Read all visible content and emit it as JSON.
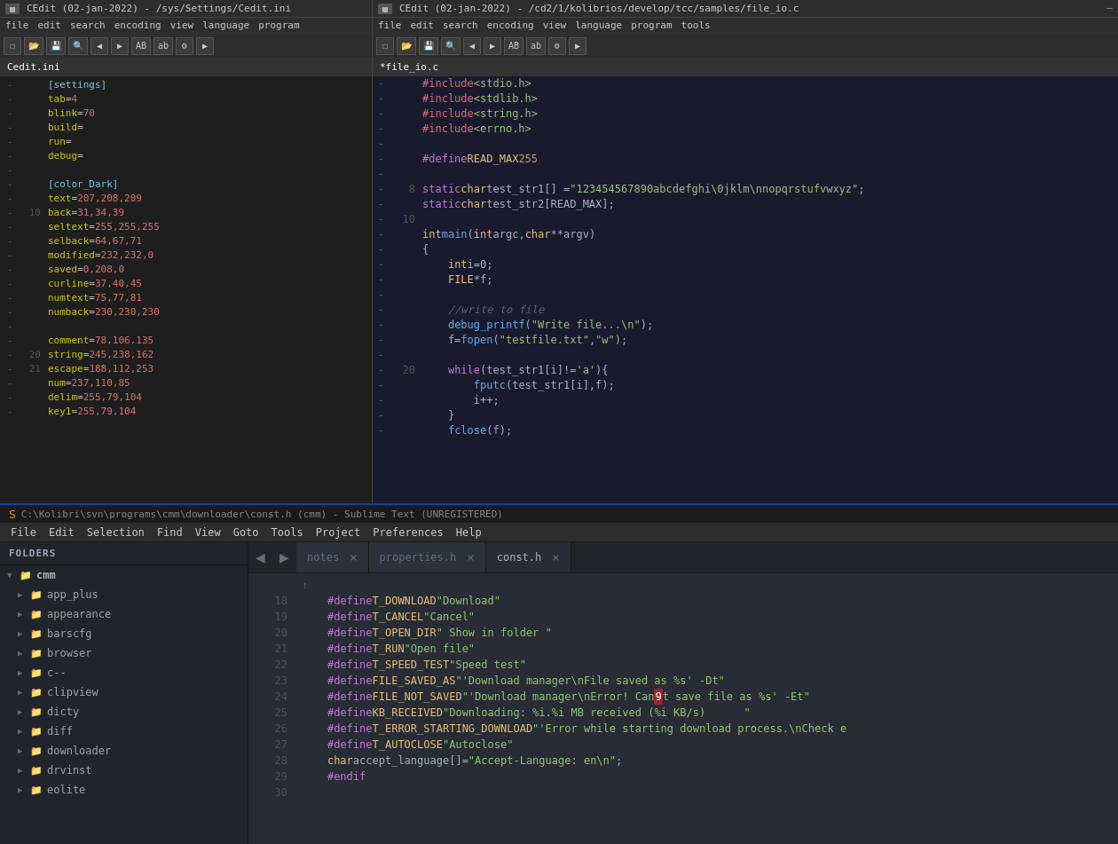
{
  "cedit_left": {
    "titlebar": "CEdit (02-jan-2022) - /sys/Settings/Cedit.ini",
    "menubar": [
      "file",
      "edit",
      "search",
      "encoding",
      "view",
      "language",
      "program"
    ],
    "toolbar_btns": [
      "☐",
      "📂",
      "💾",
      "🔍",
      "◀",
      "▶",
      "AB",
      "ab",
      "⚙",
      "▶"
    ],
    "tab": "Cedit.ini",
    "lines": [
      {
        "dash": "-",
        "num": "",
        "content": "[settings]",
        "type": "section"
      },
      {
        "dash": "-",
        "num": "",
        "content": "tab=4"
      },
      {
        "dash": "-",
        "num": "",
        "content": "blink=70"
      },
      {
        "dash": "-",
        "num": "",
        "content": "build="
      },
      {
        "dash": "-",
        "num": "",
        "content": "run="
      },
      {
        "dash": "-",
        "num": "",
        "content": "debug="
      },
      {
        "dash": "-",
        "num": ""
      },
      {
        "dash": "-",
        "num": "",
        "content": "[color_Dark]",
        "type": "section"
      },
      {
        "dash": "-",
        "num": "",
        "content": "text=207,208,209"
      },
      {
        "dash": "-",
        "num": "10",
        "content": "back=31,34,39"
      },
      {
        "dash": "-",
        "num": "",
        "content": "seltext=255,255,255"
      },
      {
        "dash": "-",
        "num": "",
        "content": "selback=64,67,71"
      },
      {
        "dash": "-",
        "num": "",
        "content": "modified=232,232,0"
      },
      {
        "dash": "-",
        "num": "",
        "content": "saved=0,208,0"
      },
      {
        "dash": "-",
        "num": "",
        "content": "curline=37,40,45"
      },
      {
        "dash": "-",
        "num": "",
        "content": "numtext=75,77,81"
      },
      {
        "dash": "-",
        "num": "",
        "content": "numback=230,230,230"
      },
      {
        "dash": "-",
        "num": ""
      },
      {
        "dash": "-",
        "num": "",
        "content": "comment=78,106,135"
      },
      {
        "dash": "-",
        "num": "20",
        "content": "string=245,238,162"
      },
      {
        "dash": "-",
        "num": "21",
        "content": "escape=188,112,253"
      },
      {
        "dash": "-",
        "num": "",
        "content": "num=237,110,85"
      },
      {
        "dash": "-",
        "num": "",
        "content": "delim=255,79,104"
      },
      {
        "dash": "-",
        "num": "",
        "content": "key1=255,79,104"
      }
    ]
  },
  "cedit_right": {
    "titlebar": "CEdit (02-jan-2022) - /cd2/1/kolibrios/develop/tcc/samples/file_io.c",
    "menubar": [
      "file",
      "edit",
      "search",
      "encoding",
      "view",
      "language",
      "program",
      "tools"
    ],
    "tab": "*file_io.c",
    "lines": [
      {
        "num": "",
        "dash": "-",
        "code": "#include <stdio.h>"
      },
      {
        "num": "",
        "dash": "-",
        "code": "#include <stdlib.h>"
      },
      {
        "num": "",
        "dash": "-",
        "code": "#include <string.h>"
      },
      {
        "num": "",
        "dash": "-",
        "code": "#include <errno.h>"
      },
      {
        "num": "",
        "dash": "-",
        "code": ""
      },
      {
        "num": "",
        "dash": "-",
        "code": "#define READ_MAX  255"
      },
      {
        "num": "",
        "dash": "-",
        "code": ""
      },
      {
        "num": "8",
        "dash": "-",
        "code": "static char test_str1[] = \"123454567890abcdefghi\\0jklm\\nnopqrstufvwxyz\";"
      },
      {
        "num": "",
        "dash": "-",
        "code": "static char test_str2[READ_MAX];"
      },
      {
        "num": "10",
        "dash": "-",
        "code": ""
      },
      {
        "num": "",
        "dash": "-",
        "code": "int main(int argc, char **argv)"
      },
      {
        "num": "",
        "dash": "-",
        "code": "{"
      },
      {
        "num": "",
        "dash": "-",
        "code": "    int i=0;"
      },
      {
        "num": "",
        "dash": "-",
        "code": "    FILE *f;"
      },
      {
        "num": "",
        "dash": "-",
        "code": ""
      },
      {
        "num": "",
        "dash": "-",
        "code": "    //write to file"
      },
      {
        "num": "",
        "dash": "-",
        "code": "    debug_printf(\"Write file...\\n\");"
      },
      {
        "num": "",
        "dash": "-",
        "code": "    f=fopen(\"testfile.txt\",\"w\");"
      },
      {
        "num": "",
        "dash": "-",
        "code": ""
      },
      {
        "num": "20",
        "dash": "-",
        "code": "    while(test_str1[i]!='a'){"
      },
      {
        "num": "",
        "dash": "-",
        "code": "        fputc(test_str1[i],f);"
      },
      {
        "num": "",
        "dash": "-",
        "code": "        i++;"
      },
      {
        "num": "",
        "dash": "-",
        "code": "    }"
      },
      {
        "num": "",
        "dash": "-",
        "code": "    fclose(f);"
      }
    ]
  },
  "sublime": {
    "titlebar": "C:\\Kolibri\\svn\\programs\\cmm\\downloader\\const.h (cmm) - Sublime Text (UNREGISTERED)",
    "menubar": [
      "File",
      "Edit",
      "Selection",
      "Find",
      "View",
      "Goto",
      "Tools",
      "Project",
      "Preferences",
      "Help"
    ],
    "sidebar_header": "FOLDERS",
    "folders": [
      {
        "name": "cmm",
        "level": 0,
        "open": true,
        "type": "folder"
      },
      {
        "name": "app_plus",
        "level": 1,
        "open": false,
        "type": "folder"
      },
      {
        "name": "appearance",
        "level": 1,
        "open": false,
        "type": "folder"
      },
      {
        "name": "barscfg",
        "level": 1,
        "open": false,
        "type": "folder"
      },
      {
        "name": "browser",
        "level": 1,
        "open": false,
        "type": "folder"
      },
      {
        "name": "c--",
        "level": 1,
        "open": false,
        "type": "folder"
      },
      {
        "name": "clipview",
        "level": 1,
        "open": false,
        "type": "folder"
      },
      {
        "name": "dicty",
        "level": 1,
        "open": false,
        "type": "folder"
      },
      {
        "name": "diff",
        "level": 1,
        "open": false,
        "type": "folder"
      },
      {
        "name": "downloader",
        "level": 1,
        "open": false,
        "type": "folder"
      },
      {
        "name": "drvinst",
        "level": 1,
        "open": false,
        "type": "folder"
      },
      {
        "name": "eolite",
        "level": 1,
        "open": false,
        "type": "folder"
      }
    ],
    "tabs": [
      {
        "name": "notes",
        "active": false
      },
      {
        "name": "properties.h",
        "active": false
      },
      {
        "name": "const.h",
        "active": true
      }
    ],
    "code_lines": [
      {
        "num": "18",
        "code": "    #define T_DOWNLOAD \"Download\"",
        "type": "define"
      },
      {
        "num": "19",
        "code": "    #define T_CANCEL \"Cancel\"",
        "type": "define"
      },
      {
        "num": "20",
        "code": "    #define T_OPEN_DIR \" Show in folder \"",
        "type": "define"
      },
      {
        "num": "21",
        "code": "    #define T_RUN \"Open file\"",
        "type": "define"
      },
      {
        "num": "22",
        "code": "    #define T_SPEED_TEST \"Speed test\"",
        "type": "define"
      },
      {
        "num": "23",
        "code": "    #define FILE_SAVED_AS \"'Download manager\\nFile saved as %s' -Dt\"",
        "type": "define"
      },
      {
        "num": "24",
        "code": "    #define FILE_NOT_SAVED \"'Download manager\\nError! Can\u0000t save file as %s' -Et\"",
        "type": "define_err"
      },
      {
        "num": "25",
        "code": "    #define KB_RECEIVED \"Downloading: %i.%i MB received (%i KB/s)      \"",
        "type": "define"
      },
      {
        "num": "26",
        "code": "    #define T_ERROR_STARTING_DOWNLOAD \"'Error while starting download process.\\nCheck e",
        "type": "define"
      },
      {
        "num": "27",
        "code": "    #define T_AUTOCLOSE \"Autoclose\"",
        "type": "define"
      },
      {
        "num": "28",
        "code": "    char accept_language[]= \"Accept-Language: en\\n\";",
        "type": "char"
      },
      {
        "num": "29",
        "code": "    #endif",
        "type": "endif"
      },
      {
        "num": "30",
        "code": "",
        "type": "empty"
      }
    ]
  }
}
